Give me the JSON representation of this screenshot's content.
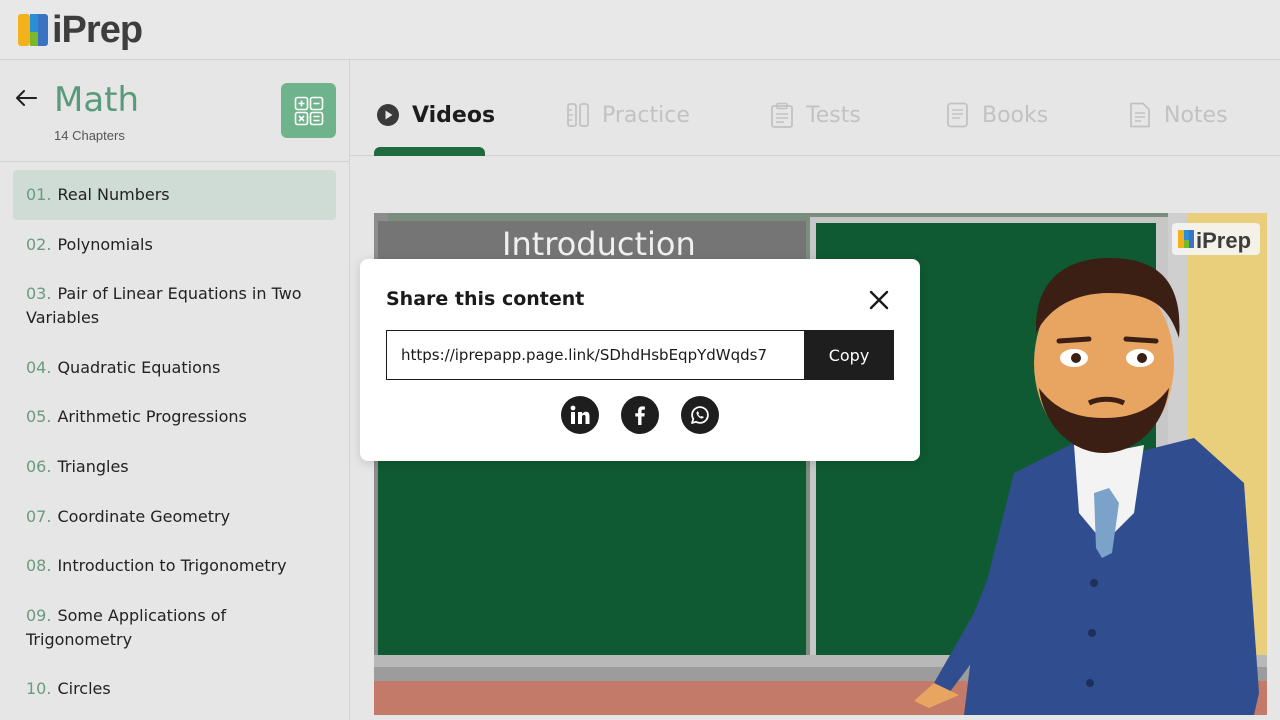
{
  "app": {
    "logo_text": "iPrep"
  },
  "sidebar": {
    "subject": "Math",
    "chapters_count": "14 Chapters",
    "chapters": [
      {
        "num": "01.",
        "title": "Real Numbers"
      },
      {
        "num": "02.",
        "title": "Polynomials"
      },
      {
        "num": "03.",
        "title": "Pair of Linear Equations in Two Variables"
      },
      {
        "num": "04.",
        "title": "Quadratic Equations"
      },
      {
        "num": "05.",
        "title": "Arithmetic Progressions"
      },
      {
        "num": "06.",
        "title": "Triangles"
      },
      {
        "num": "07.",
        "title": "Coordinate Geometry"
      },
      {
        "num": "08.",
        "title": "Introduction to Trigonometry"
      },
      {
        "num": "09.",
        "title": "Some Applications of Trigonometry"
      },
      {
        "num": "10.",
        "title": "Circles"
      }
    ]
  },
  "tabs": [
    {
      "label": "Videos",
      "icon": "play-icon",
      "active": true
    },
    {
      "label": "Practice",
      "icon": "ruler-icon",
      "active": false
    },
    {
      "label": "Tests",
      "icon": "clipboard-icon",
      "active": false
    },
    {
      "label": "Books",
      "icon": "book-icon",
      "active": false
    },
    {
      "label": "Notes",
      "icon": "notes-icon",
      "active": false
    }
  ],
  "video": {
    "board_title": "Introduction",
    "watermark": "iPrep"
  },
  "share_modal": {
    "title": "Share this content",
    "url": "https://iprepapp.page.link/SDhdHsbEqpYdWqds7",
    "copy_label": "Copy",
    "socials": [
      "linkedin-icon",
      "facebook-icon",
      "whatsapp-icon"
    ]
  },
  "colors": {
    "accent_green": "#1f6b3f",
    "subject_green": "#5a9a7c",
    "active_chapter_bg": "#cfdcd5"
  }
}
